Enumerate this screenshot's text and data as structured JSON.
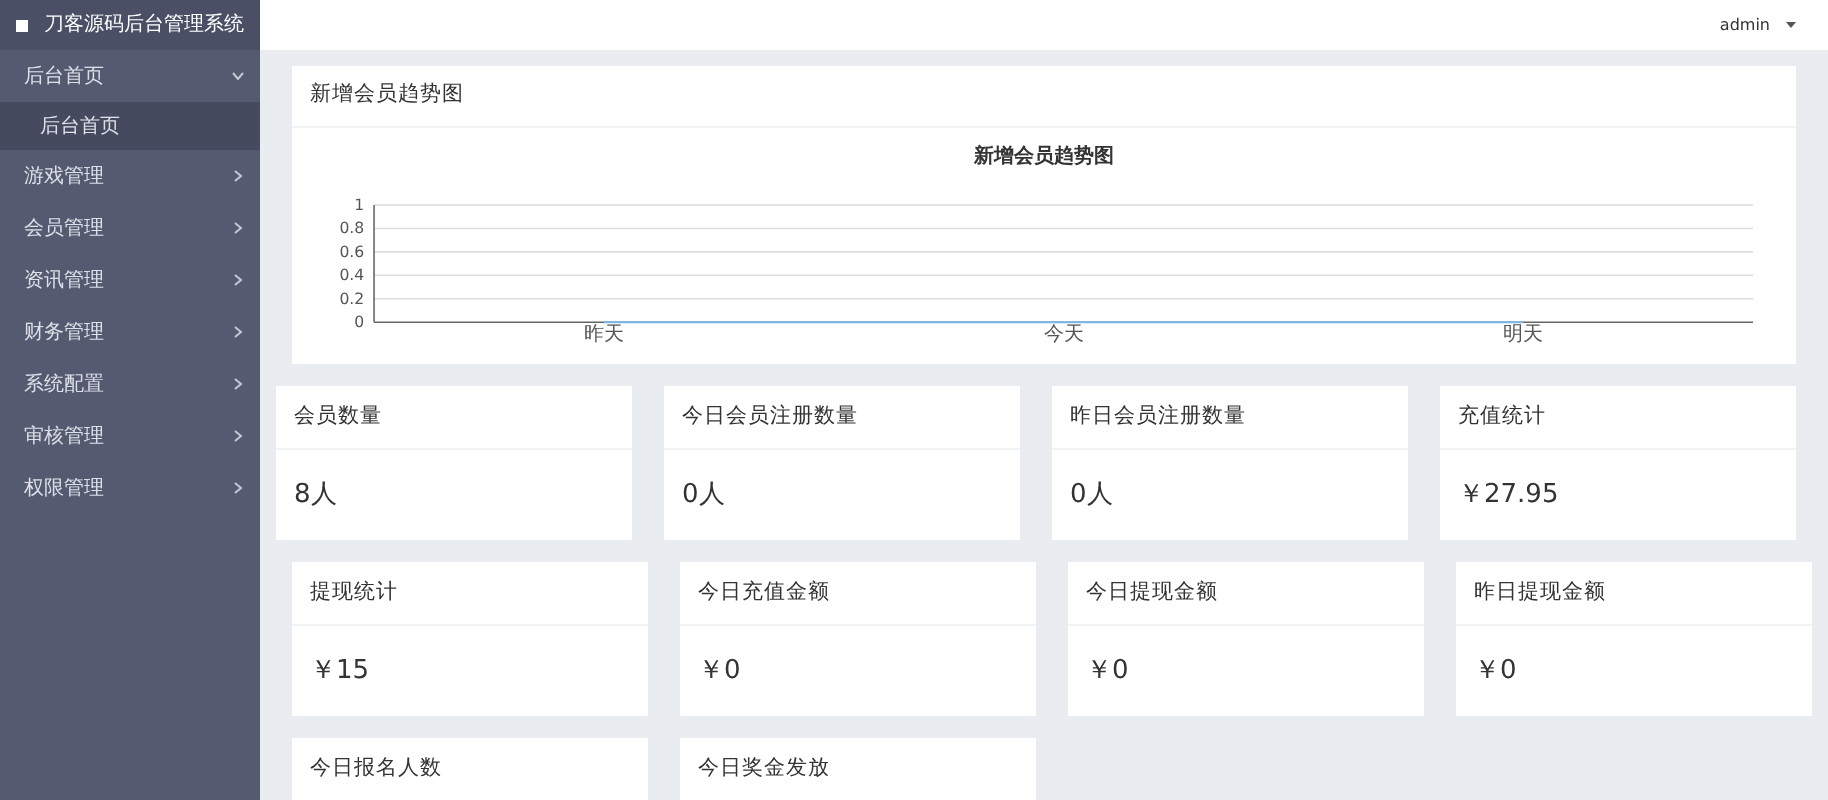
{
  "sidebar": {
    "brand": "刀客源码后台管理系统",
    "items": [
      {
        "label": "后台首页",
        "expanded": true,
        "children": [
          {
            "label": "后台首页"
          }
        ]
      },
      {
        "label": "游戏管理",
        "expanded": false
      },
      {
        "label": "会员管理",
        "expanded": false
      },
      {
        "label": "资讯管理",
        "expanded": false
      },
      {
        "label": "财务管理",
        "expanded": false
      },
      {
        "label": "系统配置",
        "expanded": false
      },
      {
        "label": "审核管理",
        "expanded": false
      },
      {
        "label": "权限管理",
        "expanded": false
      }
    ]
  },
  "header": {
    "user": "admin"
  },
  "chart_panel": {
    "title": "新增会员趋势图",
    "chart_data": {
      "type": "line",
      "title": "新增会员趋势图",
      "categories": [
        "昨天",
        "今天",
        "明天"
      ],
      "values": [
        0,
        0,
        0
      ],
      "grid": true,
      "ylim": [
        0,
        1
      ],
      "yticks": [
        0,
        0.2,
        0.4,
        0.6,
        0.8,
        {
          "value": 1,
          "label": "1"
        }
      ]
    }
  },
  "stat_rows": [
    [
      {
        "title": "会员数量",
        "value": "8人"
      },
      {
        "title": "今日会员注册数量",
        "value": "0人"
      },
      {
        "title": "昨日会员注册数量",
        "value": "0人"
      },
      {
        "title": "充值统计",
        "value": "￥27.95"
      }
    ],
    [
      {
        "title": "提现统计",
        "value": "￥15"
      },
      {
        "title": "今日充值金额",
        "value": "￥0"
      },
      {
        "title": "今日提现金额",
        "value": "￥0"
      },
      {
        "title": "昨日提现金额",
        "value": "￥0"
      }
    ],
    [
      {
        "title": "今日报名人数"
      },
      {
        "title": "今日奖金发放"
      }
    ]
  ]
}
